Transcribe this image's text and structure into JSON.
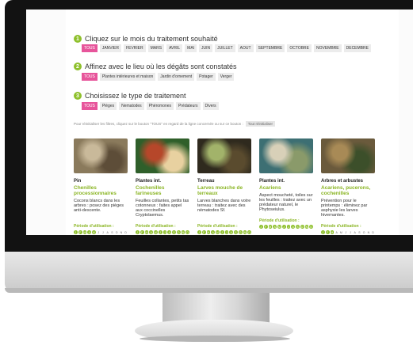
{
  "steps": [
    {
      "number": "1",
      "title": "Cliquez sur le mois du traitement souhaité",
      "chips": [
        "TOUS",
        "JANVIER",
        "FEVRIER",
        "MARS",
        "AVRIL",
        "MAI",
        "JUIN",
        "JUILLET",
        "AOUT",
        "SEPTEMBRE",
        "OCTOBRE",
        "NOVEMBRE",
        "DECEMBRE"
      ]
    },
    {
      "number": "2",
      "title": "Affinez avec le lieu où les dégâts sont constatés",
      "chips": [
        "TOUS",
        "Plantes intérieures et maison",
        "Jardin d'ornement",
        "Potager",
        "Verger"
      ]
    },
    {
      "number": "3",
      "title": "Choisissez le type de traitement",
      "chips": [
        "TOUS",
        "Pièges",
        "Nematodes",
        "Phéromones",
        "Prédateurs",
        "Divers"
      ]
    }
  ],
  "hint": {
    "text": "Pour réinitialiser les filtres, cliquez sur le bouton \"TOUS\" en regard de la ligne concernée ou sur ce bouton :",
    "reset_label": "Tout réinitialiser"
  },
  "cards": [
    {
      "category": "Pin",
      "title": "Chenilles processionnaires",
      "desc": "Cocons blancs dans les arbres : posez des pièges anti-descente.",
      "period_label": "Période d'utilisation :",
      "months": [
        "J",
        "F",
        "M",
        "A",
        "M",
        "J",
        "J",
        "A",
        "S",
        "O",
        "N",
        "D"
      ],
      "active": [
        1,
        1,
        1,
        1,
        1,
        0,
        0,
        0,
        0,
        0,
        0,
        0
      ],
      "image_colors": [
        "#8a7a5c",
        "#c9b99a",
        "#5d4d38"
      ]
    },
    {
      "category": "Plantes int.",
      "title": "Cochenilles farineuses",
      "desc": "Feuilles collantes, petits tas cotonneux : faites appel aux coccinelles Cryptolaemus.",
      "period_label": "Période d'utilisation :",
      "months": [
        "J",
        "F",
        "M",
        "A",
        "M",
        "J",
        "J",
        "A",
        "S",
        "O",
        "N",
        "D"
      ],
      "active": [
        1,
        1,
        1,
        1,
        1,
        1,
        1,
        1,
        1,
        1,
        1,
        1
      ],
      "image_colors": [
        "#2f5f2a",
        "#b6472a",
        "#e8d1a0"
      ]
    },
    {
      "category": "Terreau",
      "title": "Larves mouche de terreaux",
      "desc": "Larves blanches dans votre terreau : traitez avec des nématodes Sf.",
      "period_label": "Période d'utilisation :",
      "months": [
        "J",
        "F",
        "M",
        "A",
        "M",
        "J",
        "J",
        "A",
        "S",
        "O",
        "N",
        "D"
      ],
      "active": [
        1,
        1,
        1,
        1,
        1,
        1,
        1,
        1,
        1,
        1,
        1,
        1
      ],
      "image_colors": [
        "#2f2a1e",
        "#a2b36a",
        "#5a4b2e"
      ]
    },
    {
      "category": "Plantes int.",
      "title": "Acariens",
      "desc": "Aspect moucheté, toiles sur les feuilles : traitez avec un prédateur naturel, le Phytoseiulus.",
      "period_label": "Période d'utilisation :",
      "months": [
        "J",
        "F",
        "M",
        "A",
        "M",
        "J",
        "J",
        "A",
        "S",
        "O",
        "N",
        "D"
      ],
      "active": [
        1,
        1,
        1,
        1,
        1,
        1,
        1,
        1,
        1,
        1,
        1,
        1
      ],
      "image_colors": [
        "#3d6f73",
        "#d8d0b8",
        "#8a9a6a"
      ]
    },
    {
      "category": "Arbres et arbustes",
      "title": "Acariens, pucerons, cochenilles",
      "desc": "Prévention pour le printemps : éliminez par asphyxie les larves hivernantes.",
      "period_label": "Période d'utilisation :",
      "months": [
        "J",
        "F",
        "M",
        "A",
        "M",
        "J",
        "J",
        "A",
        "S",
        "O",
        "N",
        "D"
      ],
      "active": [
        1,
        1,
        1,
        0,
        0,
        0,
        0,
        0,
        0,
        0,
        0,
        0
      ],
      "image_colors": [
        "#6a5a3c",
        "#a88a56",
        "#3c4f2a"
      ]
    }
  ]
}
